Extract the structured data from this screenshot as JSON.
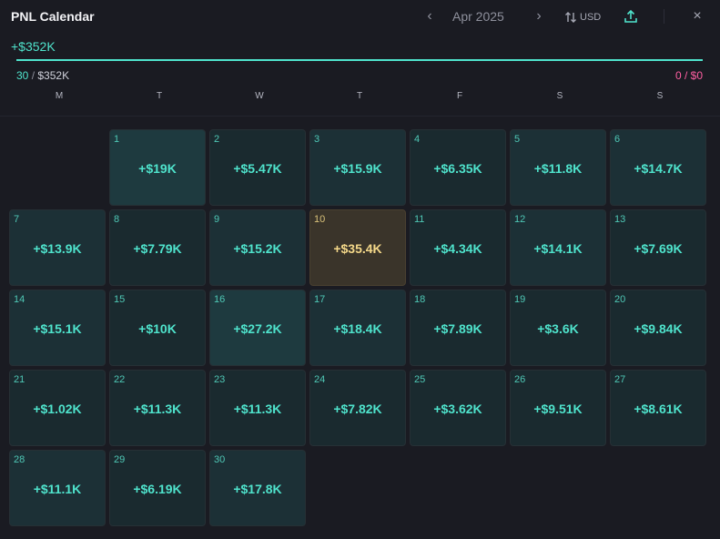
{
  "header": {
    "title": "PNL Calendar",
    "month": "Apr 2025",
    "prev_icon": "‹",
    "next_icon": "›",
    "currency": "USD",
    "currency_icon": "sort-arrows-icon",
    "share_icon": "share-upload-icon",
    "close_icon": "×"
  },
  "summary": {
    "total": "+$352K",
    "progress_fraction": 1.0,
    "positive_count": "30",
    "positive_amount": "$352K",
    "negative_count": "0",
    "negative_amount": "$0"
  },
  "weekdays": [
    "M",
    "T",
    "W",
    "T",
    "F",
    "S",
    "S"
  ],
  "calendar": {
    "start_weekday": 1,
    "days": [
      {
        "day": "1",
        "pnl": "+$19K",
        "level": "hi"
      },
      {
        "day": "2",
        "pnl": "+$5.47K",
        "level": "low"
      },
      {
        "day": "3",
        "pnl": "+$15.9K",
        "level": "mid"
      },
      {
        "day": "4",
        "pnl": "+$6.35K",
        "level": "low"
      },
      {
        "day": "5",
        "pnl": "+$11.8K",
        "level": "mid"
      },
      {
        "day": "6",
        "pnl": "+$14.7K",
        "level": "mid"
      },
      {
        "day": "7",
        "pnl": "+$13.9K",
        "level": "mid"
      },
      {
        "day": "8",
        "pnl": "+$7.79K",
        "level": "low"
      },
      {
        "day": "9",
        "pnl": "+$15.2K",
        "level": "mid"
      },
      {
        "day": "10",
        "pnl": "+$35.4K",
        "level": "best"
      },
      {
        "day": "11",
        "pnl": "+$4.34K",
        "level": "low"
      },
      {
        "day": "12",
        "pnl": "+$14.1K",
        "level": "mid"
      },
      {
        "day": "13",
        "pnl": "+$7.69K",
        "level": "low"
      },
      {
        "day": "14",
        "pnl": "+$15.1K",
        "level": "mid"
      },
      {
        "day": "15",
        "pnl": "+$10K",
        "level": "low"
      },
      {
        "day": "16",
        "pnl": "+$27.2K",
        "level": "hi"
      },
      {
        "day": "17",
        "pnl": "+$18.4K",
        "level": "mid"
      },
      {
        "day": "18",
        "pnl": "+$7.89K",
        "level": "low"
      },
      {
        "day": "19",
        "pnl": "+$3.6K",
        "level": "low"
      },
      {
        "day": "20",
        "pnl": "+$9.84K",
        "level": "low"
      },
      {
        "day": "21",
        "pnl": "+$1.02K",
        "level": "low"
      },
      {
        "day": "22",
        "pnl": "+$11.3K",
        "level": "low"
      },
      {
        "day": "23",
        "pnl": "+$11.3K",
        "level": "low"
      },
      {
        "day": "24",
        "pnl": "+$7.82K",
        "level": "low"
      },
      {
        "day": "25",
        "pnl": "+$3.62K",
        "level": "low"
      },
      {
        "day": "26",
        "pnl": "+$9.51K",
        "level": "low"
      },
      {
        "day": "27",
        "pnl": "+$8.61K",
        "level": "low"
      },
      {
        "day": "28",
        "pnl": "+$11.1K",
        "level": "mid"
      },
      {
        "day": "29",
        "pnl": "+$6.19K",
        "level": "low"
      },
      {
        "day": "30",
        "pnl": "+$17.8K",
        "level": "mid"
      }
    ]
  },
  "colors": {
    "accent": "#4fe3cc",
    "negative": "#ff5fa2",
    "best_day": "#f5d98a",
    "background": "#1a1b22"
  }
}
